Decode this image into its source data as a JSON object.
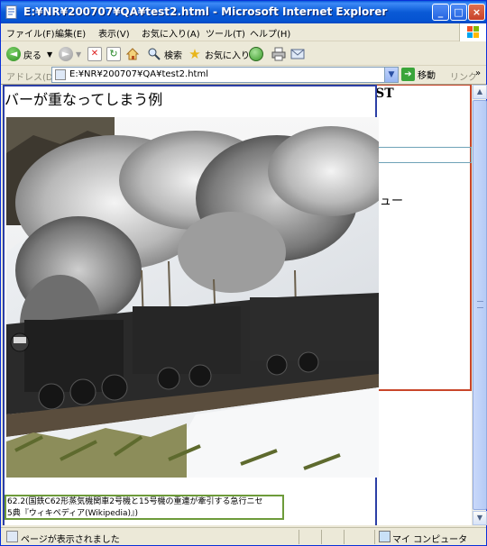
{
  "window": {
    "title": "E:¥NR¥200707¥QA¥test2.html - Microsoft Internet Explorer",
    "controls": {
      "minimize": "_",
      "maximize": "□",
      "close": "×"
    }
  },
  "menu": {
    "items": [
      "ファイル(F)",
      "編集(E)",
      "表示(V)",
      "お気に入り(A)",
      "ツール(T)",
      "ヘルプ(H)"
    ]
  },
  "toolbar": {
    "back_label": "戻る",
    "search_label": "検索",
    "favorites_label": "お気に入り"
  },
  "address": {
    "label": "アドレス(D)",
    "value": "E:¥NR¥200707¥QA¥test2.html",
    "go_label": "移動",
    "links_label": "リンク",
    "links_chevron": "»"
  },
  "page": {
    "heading": "バーが重なってしまう例",
    "caption_line1": "62.2(国鉄C62形蒸気機関車2号機と15号機の重連が牽引する急行ニセ",
    "caption_line2": "5典『ウィキペディア(Wikipedia)』)",
    "sidebar_title": "TEST",
    "sidebar_menu_fragment": "ュー"
  },
  "status": {
    "text": "ページが表示されました",
    "zone": "マイ コンピュータ"
  },
  "icons": [
    "ie-page-icon",
    "windows-logo-icon",
    "back-icon",
    "forward-icon",
    "stop-icon",
    "refresh-icon",
    "home-icon",
    "search-icon",
    "favorites-star-icon",
    "history-icon",
    "print-icon",
    "mail-icon",
    "go-arrow-icon",
    "computer-icon"
  ],
  "colors": {
    "titlebar": "#0a5bdb",
    "main_column_border": "#2c3fa6",
    "sidebar_border": "#c9462a",
    "caption_border": "#6d9b3a"
  }
}
